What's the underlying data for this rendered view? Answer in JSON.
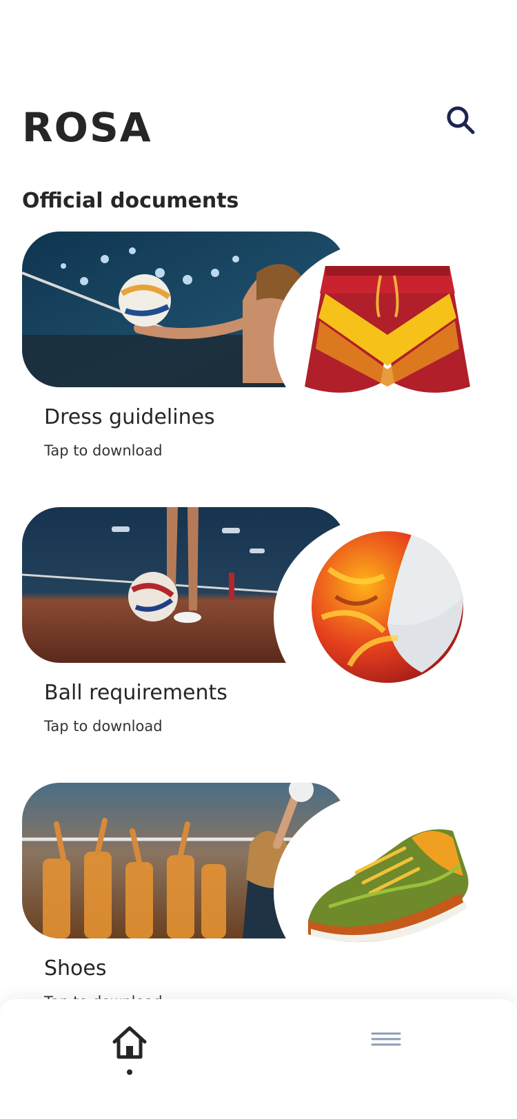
{
  "app": {
    "title": "ROSA"
  },
  "section": {
    "title": "Official documents"
  },
  "cards": [
    {
      "title": "Dress guidelines",
      "subtitle": "Tap to download",
      "product_icon": "shorts-icon"
    },
    {
      "title": "Ball requirements",
      "subtitle": "Tap to download",
      "product_icon": "ball-icon"
    },
    {
      "title": "Shoes",
      "subtitle": "Tap to download",
      "product_icon": "shoe-icon"
    }
  ],
  "nav": {
    "items": [
      "home-icon",
      "menu-icon"
    ],
    "active": "home"
  },
  "colors": {
    "accent": "#1c2451",
    "text": "#262626",
    "menu": "#8a9bb5"
  }
}
